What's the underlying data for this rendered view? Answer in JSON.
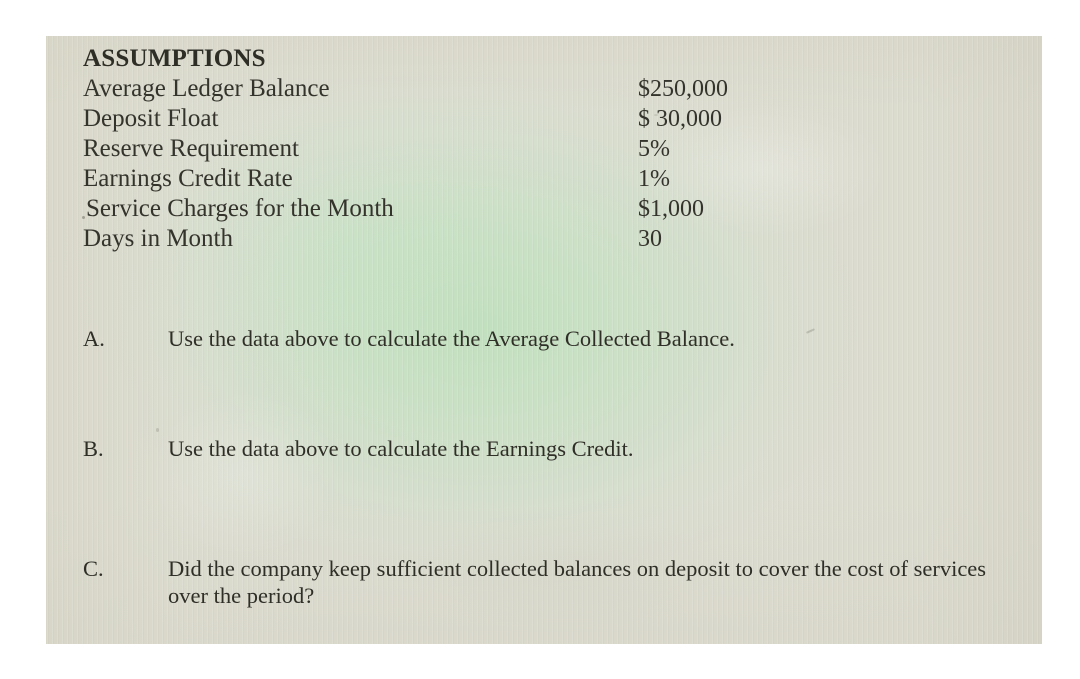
{
  "document": {
    "assumptions": {
      "title": "ASSUMPTIONS",
      "rows": [
        {
          "label": "Average Ledger Balance",
          "value": "$250,000"
        },
        {
          "label": "Deposit Float",
          "value": "$ 30,000"
        },
        {
          "label": "Reserve Requirement",
          "value": "5%"
        },
        {
          "label": "Earnings Credit Rate",
          "value": "1%"
        },
        {
          "label": "Service Charges for the Month",
          "value": "$1,000"
        },
        {
          "label": "Days in Month",
          "value": "30"
        }
      ]
    },
    "questions": [
      {
        "letter": "A.",
        "text": "Use the data above to calculate the Average Collected Balance."
      },
      {
        "letter": "B.",
        "text": "Use the data above to calculate the Earnings Credit."
      },
      {
        "letter": "C.",
        "text": "Did the company keep sufficient collected balances on deposit to cover the cost of services over the period?"
      }
    ]
  },
  "colors": {
    "page_background": "#dcdcd0",
    "green_cast": "#d3e3cf",
    "text": "#34332c",
    "surround": "#ffffff"
  }
}
